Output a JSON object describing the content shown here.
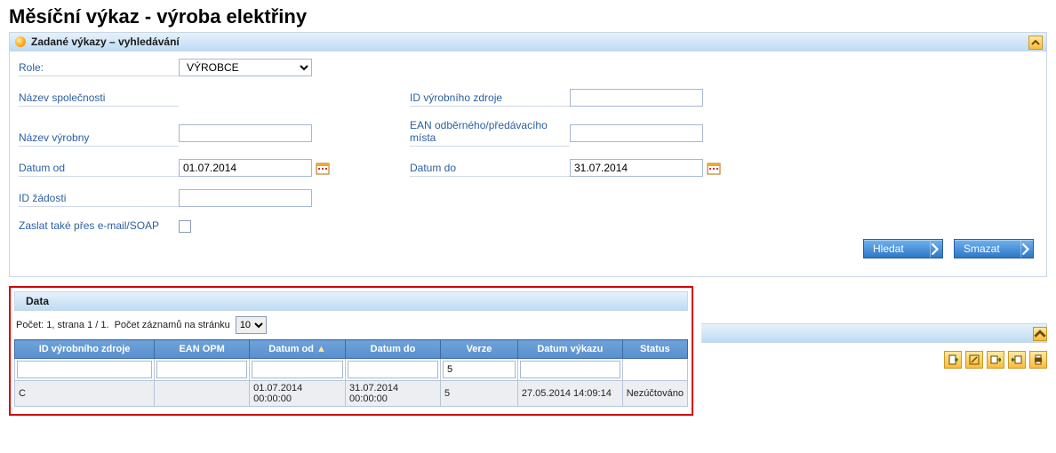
{
  "page": {
    "title": "Měsíční výkaz - výroba elektřiny"
  },
  "search_panel": {
    "title": "Zadané výkazy – vyhledávání",
    "labels": {
      "role": "Role:",
      "company": "Název společnosti",
      "plant": "Název výrobny",
      "date_from": "Datum od",
      "request_id": "ID žádosti",
      "email_soap": "Zaslat také přes e-mail/SOAP",
      "source_id": "ID výrobního zdroje",
      "ean_point": "EAN odběrného/předávacího místa",
      "date_to": "Datum do"
    },
    "values": {
      "role": "VÝROBCE",
      "date_from": "01.07.2014",
      "date_to": "31.07.2014"
    },
    "buttons": {
      "search": "Hledat",
      "clear": "Smazat"
    }
  },
  "data_panel": {
    "title": "Data",
    "pager": {
      "summary": "Počet: 1, strana 1 / 1.",
      "page_size_label": "Počet záznamů na stránku",
      "page_size": "10"
    },
    "columns": {
      "source_id": "ID výrobního zdroje",
      "ean_opm": "EAN OPM",
      "date_from": "Datum od",
      "date_to": "Datum do",
      "version": "Verze",
      "report_date": "Datum výkazu",
      "status": "Status"
    },
    "filters": {
      "version": "5"
    },
    "rows": [
      {
        "source_id": "C",
        "ean_opm": "",
        "date_from": "01.07.2014 00:00:00",
        "date_to": "31.07.2014 00:00:00",
        "version": "5",
        "report_date": "27.05.2014 14:09:14",
        "status": "Nezúčtováno"
      }
    ]
  },
  "icons": {
    "collapse": "chevron-up",
    "tools": [
      "new-icon",
      "edit-icon",
      "export-icon",
      "import-icon",
      "print-icon"
    ]
  }
}
